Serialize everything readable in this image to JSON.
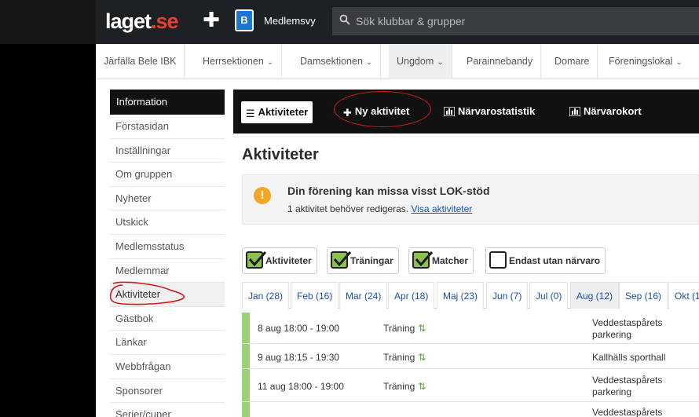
{
  "topbar": {
    "logo_main": "laget",
    "logo_tld": ".se",
    "club_logo_letter": "B",
    "member_view": "Medlemsvy",
    "search_placeholder": "Sök klubbar & grupper"
  },
  "nav": {
    "items": [
      {
        "label": "Järfälla Bele IBK",
        "dropdown": false
      },
      {
        "label": "Herrsektionen",
        "dropdown": true
      },
      {
        "label": "Damsektionen",
        "dropdown": true
      },
      {
        "label": "Ungdom",
        "dropdown": true
      },
      {
        "label": "Parainnebandy",
        "dropdown": false
      },
      {
        "label": "Domare",
        "dropdown": false
      },
      {
        "label": "Föreningslokal",
        "dropdown": true
      }
    ],
    "chevron": "⌄"
  },
  "sidebar": {
    "header": "Information",
    "items": [
      "Förstasidan",
      "Inställningar",
      "Om gruppen",
      "Nyheter",
      "Utskick",
      "Medlemsstatus",
      "Medlemmar",
      "Aktiviteter",
      "Gästbok",
      "Länkar",
      "Webbfrågan",
      "Sponsorer",
      "Serier/cuper"
    ],
    "active": "Aktiviteter"
  },
  "toolbar": {
    "activities": "Aktiviteter",
    "new_activity": "Ny aktivitet",
    "attendance_stats": "Närvarostatistik",
    "attendance_card": "Närvarokort"
  },
  "page": {
    "title": "Aktiviteter"
  },
  "alert": {
    "icon": "!",
    "title": "Din förening kan missa visst LOK-stöd",
    "text": "1 aktivitet behöver redigeras.",
    "link": "Visa aktiviteter"
  },
  "filters": {
    "activities": "Aktiviteter",
    "trainings": "Träningar",
    "matches": "Matcher",
    "only_without": "Endast utan närvaro"
  },
  "months": [
    "Jan (28)",
    "Feb (16)",
    "Mar (24)",
    "Apr (18)",
    "Maj (23)",
    "Jun (7)",
    "Jul (0)",
    "Aug (12)",
    "Sep (16)",
    "Okt (1"
  ],
  "active_month": "Aug (12)",
  "rows": [
    {
      "date": "8 aug 18:00 - 19:00",
      "type": "Träning",
      "place": "Veddestaspårets parkering"
    },
    {
      "date": "9 aug 18:15 - 19:30",
      "type": "Träning",
      "place": "Kallhälls sporthall"
    },
    {
      "date": "11 aug 18:00 - 19:00",
      "type": "Träning",
      "place": "Veddestaspårets parkering"
    },
    {
      "date": "",
      "type": "",
      "place": "Veddestaspårets"
    }
  ],
  "colors": {
    "accent_red": "#e8402f",
    "link_blue": "#1a4fb5",
    "check_green": "#8bc34a",
    "row_bar_green": "#9ad17a",
    "alert_orange": "#f5a623"
  }
}
